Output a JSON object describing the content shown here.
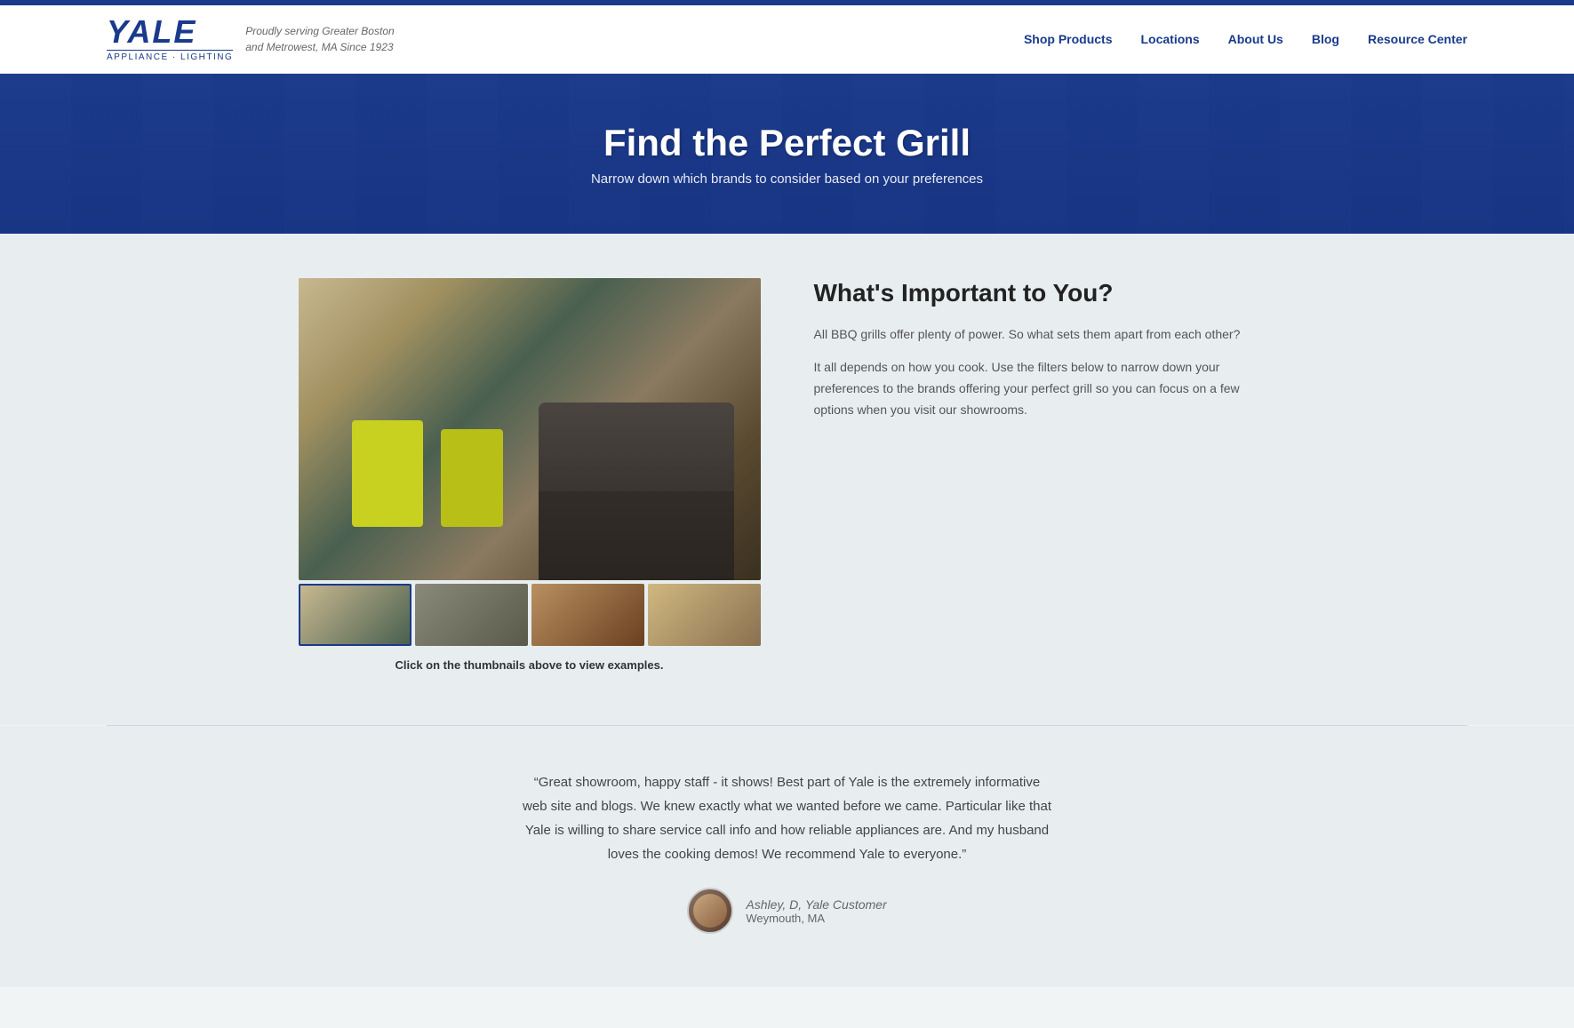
{
  "topBar": {},
  "header": {
    "logo": {
      "yale": "YALE",
      "sub": "APPLIANCE · LIGHTING",
      "tagline": "Proudly serving Greater Boston\nand Metrowest, MA Since 1923"
    },
    "nav": {
      "items": [
        {
          "label": "Shop Products",
          "href": "#"
        },
        {
          "label": "Locations",
          "href": "#"
        },
        {
          "label": "About Us",
          "href": "#"
        },
        {
          "label": "Blog",
          "href": "#"
        },
        {
          "label": "Resource Center",
          "href": "#"
        }
      ]
    }
  },
  "hero": {
    "title": "Find the Perfect Grill",
    "subtitle": "Narrow down which brands to consider based on your preferences"
  },
  "main": {
    "image_caption": "Click on the thumbnails above to view examples.",
    "heading": "What's Important to You?",
    "paragraphs": [
      "All BBQ grills offer plenty of power. So what sets them apart from each other?",
      "It all depends on how you cook. Use the filters below to narrow down your preferences to the brands offering your perfect grill so you can focus on a few options when you visit our showrooms."
    ]
  },
  "testimonial": {
    "quote": "“Great showroom, happy staff - it shows! Best part of Yale is the extremely informative web site and blogs. We knew exactly what we wanted before we came. Particular like that Yale is willing to share service call info and how reliable appliances are. And my husband loves the cooking demos! We recommend Yale to everyone.”",
    "author_name": "Ashley, D,",
    "author_title": "Yale Customer",
    "author_location": "Weymouth, MA"
  }
}
